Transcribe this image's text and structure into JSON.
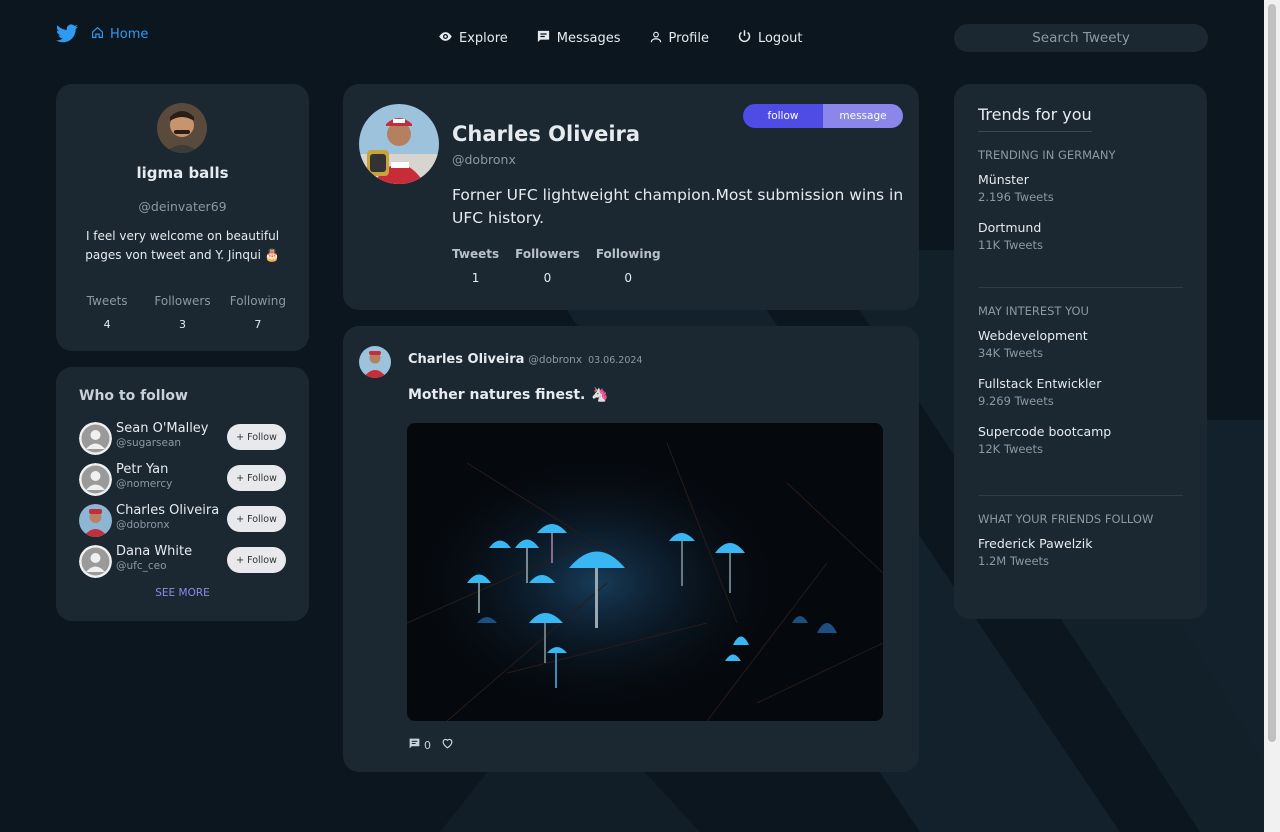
{
  "colors": {
    "accent": "#2f9bf0",
    "follow": "#4f4ce6",
    "message": "#8a86ea",
    "card": "#1b2731",
    "background": "#0b161f"
  },
  "nav": {
    "logo_icon": "twitter-bird-icon",
    "home": "Home",
    "links": [
      "Explore",
      "Messages",
      "Profile",
      "Logout"
    ],
    "search_placeholder": "Search Tweety"
  },
  "me": {
    "name": "ligma balls",
    "handle": "@deinvater69",
    "bio": "I feel very welcome on beautiful pages von tweet and Y. Jinqui 🎂",
    "stats": [
      {
        "label": "Tweets",
        "value": "4"
      },
      {
        "label": "Followers",
        "value": "3"
      },
      {
        "label": "Following",
        "value": "7"
      }
    ]
  },
  "who_to_follow": {
    "title": "Who to follow",
    "follow_label": "+ Follow",
    "people": [
      {
        "name": "Sean O'Malley",
        "handle": "@sugarsean"
      },
      {
        "name": "Petr Yan",
        "handle": "@nomercy"
      },
      {
        "name": "Charles Oliveira",
        "handle": "@dobronx"
      },
      {
        "name": "Dana White",
        "handle": "@ufc_ceo"
      }
    ],
    "see_more": "SEE MORE"
  },
  "profile": {
    "name": "Charles Oliveira",
    "handle": "@dobronx",
    "follow": "follow",
    "message": "message",
    "bio": "Forner UFC lightweight champion.Most submission wins in UFC history.",
    "stats": [
      {
        "label": "Tweets",
        "value": "1"
      },
      {
        "label": "Followers",
        "value": "0"
      },
      {
        "label": "Following",
        "value": "0"
      }
    ]
  },
  "tweet": {
    "name": "Charles Oliveira",
    "handle": "@dobronx",
    "date": "03.06.2024",
    "text": "Mother natures finest.",
    "emoji": "🦄",
    "comments": "0"
  },
  "trends": {
    "title": "Trends for you",
    "sections": [
      {
        "heading": "TRENDING IN GERMANY",
        "items": [
          {
            "topic": "Münster",
            "count": "2.196 Tweets"
          },
          {
            "topic": "Dortmund",
            "count": "11K Tweets"
          }
        ]
      },
      {
        "heading": "MAY INTEREST YOU",
        "items": [
          {
            "topic": "Webdevelopment",
            "count": "34K Tweets"
          },
          {
            "topic": "Fullstack Entwickler",
            "count": "9.269 Tweets"
          },
          {
            "topic": "Supercode bootcamp",
            "count": "12K Tweets"
          }
        ]
      },
      {
        "heading": "WHAT YOUR FRIENDS FOLLOW",
        "items": [
          {
            "topic": "Frederick Pawelzik",
            "count": "1.2M Tweets"
          }
        ]
      }
    ]
  }
}
